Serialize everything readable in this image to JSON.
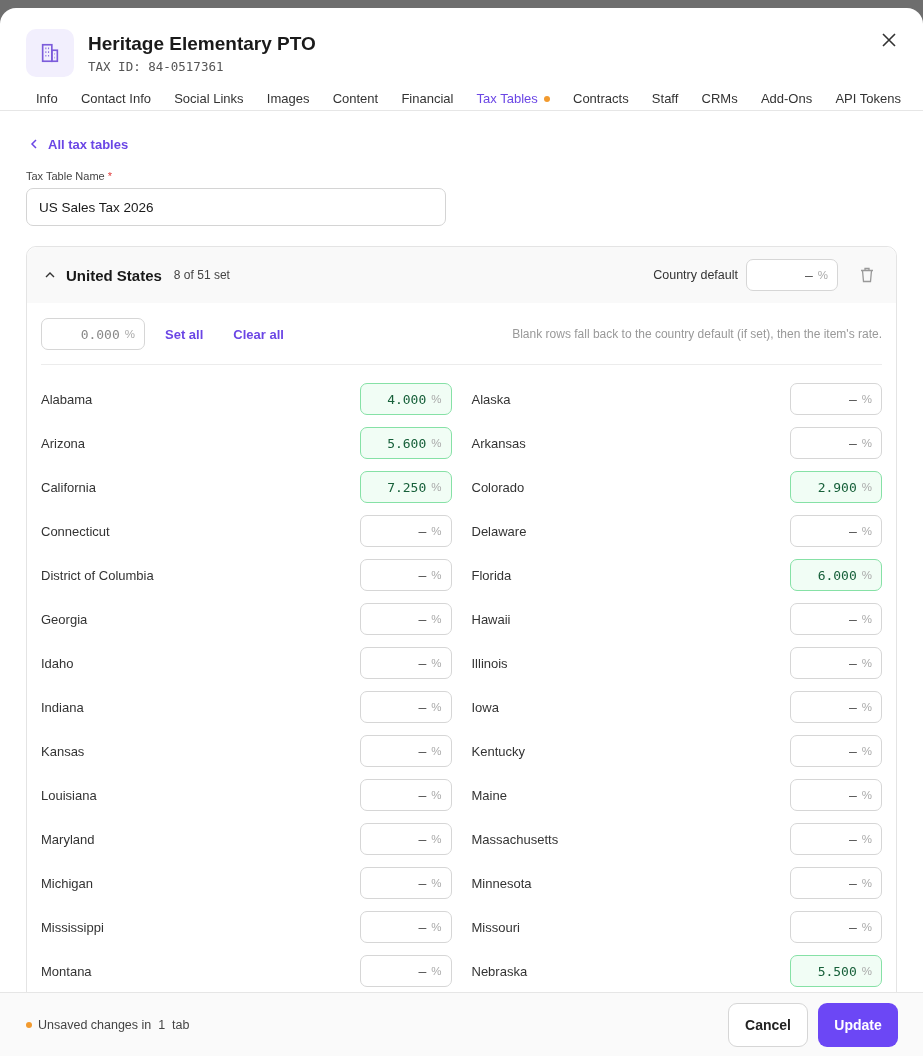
{
  "header": {
    "title": "Heritage Elementary PTO",
    "subtitle": "TAX ID: 84-0517361"
  },
  "tabs": [
    {
      "label": "Info",
      "selected": false,
      "unsaved": false
    },
    {
      "label": "Contact Info",
      "selected": false,
      "unsaved": false
    },
    {
      "label": "Social Links",
      "selected": false,
      "unsaved": false
    },
    {
      "label": "Images",
      "selected": false,
      "unsaved": false
    },
    {
      "label": "Content",
      "selected": false,
      "unsaved": false
    },
    {
      "label": "Financial",
      "selected": false,
      "unsaved": false
    },
    {
      "label": "Tax Tables",
      "selected": true,
      "unsaved": true
    },
    {
      "label": "Contracts",
      "selected": false,
      "unsaved": false
    },
    {
      "label": "Staff",
      "selected": false,
      "unsaved": false
    },
    {
      "label": "CRMs",
      "selected": false,
      "unsaved": false
    },
    {
      "label": "Add-Ons",
      "selected": false,
      "unsaved": false
    },
    {
      "label": "API Tokens",
      "selected": false,
      "unsaved": false
    }
  ],
  "back_link": "All tax tables",
  "name_field": {
    "label": "Tax Table Name",
    "required_mark": "*",
    "value": "US Sales Tax 2026"
  },
  "country": {
    "name": "United States",
    "count": "8 of 51 set",
    "expanded": true,
    "default_label": "Country default",
    "default_value": "–",
    "unit": "%",
    "bulk_value": "0.000",
    "set_all": "Set all",
    "clear_all": "Clear all",
    "hint": "Blank rows fall back to the country default (if set), then the item's rate.",
    "states": [
      {
        "name": "Alabama",
        "value": "4.000",
        "set": true
      },
      {
        "name": "Alaska",
        "value": "–",
        "set": false
      },
      {
        "name": "Arizona",
        "value": "5.600",
        "set": true
      },
      {
        "name": "Arkansas",
        "value": "–",
        "set": false
      },
      {
        "name": "California",
        "value": "7.250",
        "set": true
      },
      {
        "name": "Colorado",
        "value": "2.900",
        "set": true
      },
      {
        "name": "Connecticut",
        "value": "–",
        "set": false
      },
      {
        "name": "Delaware",
        "value": "–",
        "set": false
      },
      {
        "name": "District of Columbia",
        "value": "–",
        "set": false
      },
      {
        "name": "Florida",
        "value": "6.000",
        "set": true
      },
      {
        "name": "Georgia",
        "value": "–",
        "set": false
      },
      {
        "name": "Hawaii",
        "value": "–",
        "set": false
      },
      {
        "name": "Idaho",
        "value": "–",
        "set": false
      },
      {
        "name": "Illinois",
        "value": "–",
        "set": false
      },
      {
        "name": "Indiana",
        "value": "–",
        "set": false
      },
      {
        "name": "Iowa",
        "value": "–",
        "set": false
      },
      {
        "name": "Kansas",
        "value": "–",
        "set": false
      },
      {
        "name": "Kentucky",
        "value": "–",
        "set": false
      },
      {
        "name": "Louisiana",
        "value": "–",
        "set": false
      },
      {
        "name": "Maine",
        "value": "–",
        "set": false
      },
      {
        "name": "Maryland",
        "value": "–",
        "set": false
      },
      {
        "name": "Massachusetts",
        "value": "–",
        "set": false
      },
      {
        "name": "Michigan",
        "value": "–",
        "set": false
      },
      {
        "name": "Minnesota",
        "value": "–",
        "set": false
      },
      {
        "name": "Mississippi",
        "value": "–",
        "set": false
      },
      {
        "name": "Missouri",
        "value": "–",
        "set": false
      },
      {
        "name": "Montana",
        "value": "–",
        "set": false
      },
      {
        "name": "Nebraska",
        "value": "5.500",
        "set": true
      }
    ]
  },
  "footer": {
    "status": "Unsaved changes in  1  tab",
    "unsaved": true,
    "cancel": "Cancel",
    "update": "Update"
  }
}
